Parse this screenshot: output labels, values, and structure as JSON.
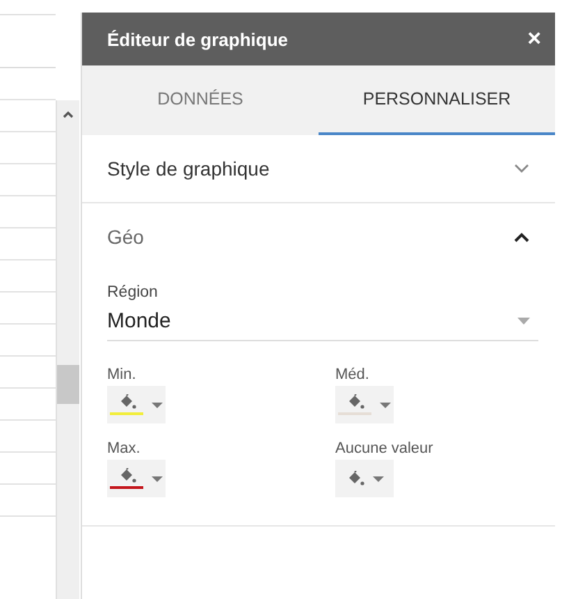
{
  "window": {
    "title": "Éditeur de graphique",
    "close": "×"
  },
  "tabs": [
    {
      "label": "DONNÉES",
      "selected": false
    },
    {
      "label": "PERSONNALISER",
      "selected": true
    }
  ],
  "sections": [
    {
      "title": "Style de graphique",
      "expanded": false
    },
    {
      "title": "Géo",
      "expanded": true,
      "region": {
        "label": "Région",
        "value": "Monde"
      },
      "colors": [
        {
          "label": "Min.",
          "color": "#f2ee3c"
        },
        {
          "label": "Méd.",
          "color": "#e6ded6"
        },
        {
          "label": "Max.",
          "color": "#c4161c"
        },
        {
          "label": "Aucune valeur"
        }
      ]
    }
  ]
}
